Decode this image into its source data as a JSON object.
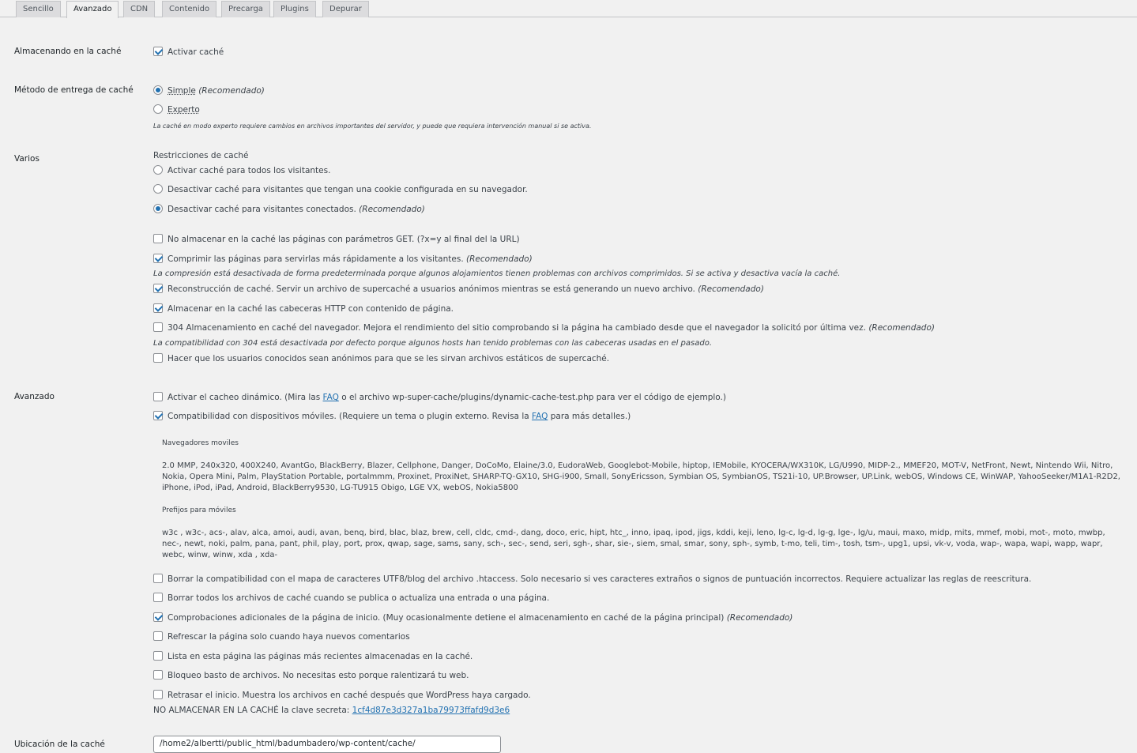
{
  "tabs": [
    "Sencillo",
    "Avanzado",
    "CDN",
    "Contenido",
    "Precarga",
    "Plugins",
    "Depurar"
  ],
  "active_tab": "Avanzado",
  "caching": {
    "label": "Almacenando en la caché",
    "option": "Activar caché",
    "checked": true
  },
  "delivery": {
    "label": "Método de entrega de caché",
    "simple": "Simple",
    "simple_note": "(Recomendado)",
    "expert": "Experto",
    "note": "La caché en modo experto requiere cambios en archivos importantes del servidor, y puede que requiera intervención manual si se activa."
  },
  "misc": {
    "label": "Varios",
    "restrictions_title": "Restricciones de caché",
    "r1": "Activar caché para todos los visitantes.",
    "r2": "Desactivar caché para visitantes que tengan una cookie configurada en su navegador.",
    "r3": "Desactivar caché para visitantes conectados.",
    "r3_note": "(Recomendado)",
    "get_params": "No almacenar en la caché las páginas con parámetros GET. (?x=y al final del la URL)",
    "compress": "Comprimir las páginas para servirlas más rápidamente a los visitantes.",
    "compress_note": "(Recomendado)",
    "compress_info": "La compresión está desactivada de forma predeterminada porque algunos alojamientos tienen problemas con archivos comprimidos. Si se activa y desactiva vacía la caché.",
    "rebuild": "Reconstrucción de caché. Servir un archivo de supercaché a usuarios anónimos mientras se está generando un nuevo archivo.",
    "rebuild_note": "(Recomendado)",
    "headers": "Almacenar en la caché las cabeceras HTTP con contenido de página.",
    "browser304": "304 Almacenamiento en caché del navegador. Mejora el rendimiento del sitio comprobando si la página ha cambiado desde que el navegador la solicitó por última vez.",
    "browser304_note": "(Recomendado)",
    "browser304_info": "La compatibilidad con 304 está desactivada por defecto porque algunos hosts han tenido problemas con las cabeceras usadas en el pasado.",
    "anon": "Hacer que los usuarios conocidos sean anónimos para que se les sirvan archivos estáticos de supercaché."
  },
  "advanced": {
    "label": "Avanzado",
    "dynamic_a": "Activar el cacheo dinámico. (Mira las",
    "faq": "FAQ",
    "dynamic_b": "o el archivo wp-super-cache/plugins/dynamic-cache-test.php para ver el código de ejemplo.)",
    "mobile_a": "Compatibilidad con dispositivos móviles. (Requiere un tema o plugin externo. Revisa la",
    "mobile_b": "para más detalles.)",
    "mobile_browsers_title": "Navegadores moviles",
    "mobile_browsers": "2.0 MMP, 240x320, 400X240, AvantGo, BlackBerry, Blazer, Cellphone, Danger, DoCoMo, Elaine/3.0, EudoraWeb, Googlebot-Mobile, hiptop, IEMobile, KYOCERA/WX310K, LG/U990, MIDP-2., MMEF20, MOT-V, NetFront, Newt, Nintendo Wii, Nitro, Nokia, Opera Mini, Palm, PlayStation Portable, portalmmm, Proxinet, ProxiNet, SHARP-TQ-GX10, SHG-i900, Small, SonyEricsson, Symbian OS, SymbianOS, TS21i-10, UP.Browser, UP.Link, webOS, Windows CE, WinWAP, YahooSeeker/M1A1-R2D2, iPhone, iPod, iPad, Android, BlackBerry9530, LG-TU915 Obigo, LGE VX, webOS, Nokia5800",
    "mobile_prefixes_title": "Prefijos para móviles",
    "mobile_prefixes": "w3c , w3c-, acs-, alav, alca, amoi, audi, avan, benq, bird, blac, blaz, brew, cell, cldc, cmd-, dang, doco, eric, hipt, htc_, inno, ipaq, ipod, jigs, kddi, keji, leno, lg-c, lg-d, lg-g, lge-, lg/u, maui, maxo, midp, mits, mmef, mobi, mot-, moto, mwbp, nec-, newt, noki, palm, pana, pant, phil, play, port, prox, qwap, sage, sams, sany, sch-, sec-, send, seri, sgh-, shar, sie-, siem, smal, smar, sony, sph-, symb, t-mo, teli, tim-, tosh, tsm-, upg1, upsi, vk-v, voda, wap-, wapa, wapi, wapp, wapr, webc, winw, winw, xda , xda-",
    "utf8": "Borrar la compatibilidad con el mapa de caracteres UTF8/blog del archivo .htaccess. Solo necesario si ves caracteres extraños o signos de puntuación incorrectos. Requiere actualizar las reglas de reescritura.",
    "clear_on_publish": "Borrar todos los archivos de caché cuando se publica o actualiza una entrada o una página.",
    "front_page": "Comprobaciones adicionales de la página de inicio. (Muy ocasionalmente detiene el almacenamiento en caché de la página principal)",
    "front_page_note": "(Recomendado)",
    "refresh_comments": "Refrescar la página solo cuando haya nuevos comentarios",
    "list_recent": "Lista en esta página las páginas más recientes almacenadas en la caché.",
    "coarse_lock": "Bloqueo basto de archivos. No necesitas esto porque ralentizará tu web.",
    "late_init": "Retrasar el inicio. Muestra los archivos en caché después que WordPress haya cargado.",
    "secret_a": "NO ALMACENAR EN LA CACHÉ",
    "secret_b": "la clave secreta:",
    "secret_key": "1cf4d87e3d327a1ba79973ffafd9d3e6"
  },
  "location": {
    "label": "Ubicación de la caché",
    "value": "/home2/albertti/public_html/badumbadero/wp-content/cache/"
  }
}
